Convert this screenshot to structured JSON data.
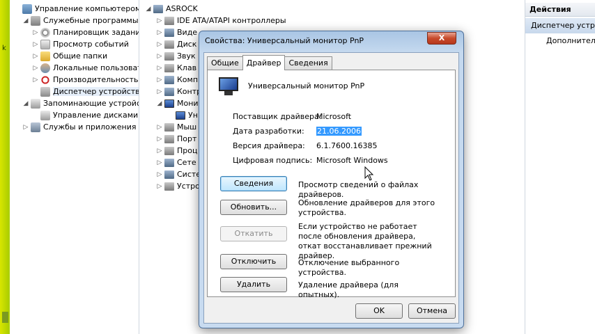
{
  "left_tree": {
    "items": [
      {
        "label": "Управление компьютером (л",
        "icon": "computer-management-icon",
        "expander": ""
      },
      {
        "label": "Служебные программы",
        "icon": "tools-icon",
        "expander": "◢"
      },
      {
        "label": "Планировщик заданий",
        "icon": "task-scheduler-icon",
        "expander": "▷"
      },
      {
        "label": "Просмотр событий",
        "icon": "event-viewer-icon",
        "expander": "▷"
      },
      {
        "label": "Общие папки",
        "icon": "shared-folders-icon",
        "expander": "▷"
      },
      {
        "label": "Локальные пользовате",
        "icon": "local-users-icon",
        "expander": "▷"
      },
      {
        "label": "Производительность",
        "icon": "performance-icon",
        "expander": "▷"
      },
      {
        "label": "Диспетчер устройств",
        "icon": "device-manager-icon",
        "expander": ""
      },
      {
        "label": "Запоминающие устройст",
        "icon": "storage-icon",
        "expander": "◢"
      },
      {
        "label": "Управление дисками",
        "icon": "disk-management-icon",
        "expander": ""
      },
      {
        "label": "Службы и приложения",
        "icon": "services-icon",
        "expander": "▷"
      }
    ]
  },
  "device_tree": {
    "root": "ASROCK",
    "items": [
      {
        "label": "IDE ATA/ATAPI контроллеры",
        "expander": "▷"
      },
      {
        "label": "Виде",
        "expander": "▷"
      },
      {
        "label": "Диск",
        "expander": "▷"
      },
      {
        "label": "Звук",
        "expander": "▷"
      },
      {
        "label": "Клав",
        "expander": "▷"
      },
      {
        "label": "Комп",
        "expander": "▷"
      },
      {
        "label": "Контр",
        "expander": "▷"
      },
      {
        "label": "Мони",
        "expander": "◢"
      },
      {
        "label": "Ун",
        "expander": ""
      },
      {
        "label": "Мыш",
        "expander": "▷"
      },
      {
        "label": "Порт",
        "expander": "▷"
      },
      {
        "label": "Проц",
        "expander": "▷"
      },
      {
        "label": "Сете",
        "expander": "▷"
      },
      {
        "label": "Систе",
        "expander": "▷"
      },
      {
        "label": "Устро",
        "expander": "▷"
      }
    ]
  },
  "actions_pane": {
    "header": "Действия",
    "selected": "Диспетчер устрой",
    "more": "Дополнитель"
  },
  "dialog": {
    "title": "Свойства: Универсальный монитор PnP",
    "close_label": "X",
    "tabs": [
      "Общие",
      "Драйвер",
      "Сведения"
    ],
    "active_tab": "Драйвер",
    "device_name": "Универсальный монитор PnP",
    "info": {
      "provider_label": "Поставщик драйвера:",
      "provider_value": "Microsoft",
      "date_label": "Дата разработки:",
      "date_value": "21.06.2006",
      "version_label": "Версия драйвера:",
      "version_value": "6.1.7600.16385",
      "signature_label": "Цифровая подпись:",
      "signature_value": "Microsoft Windows"
    },
    "buttons": {
      "details_label": "Сведения",
      "details_desc": "Просмотр сведений о файлах драйверов.",
      "update_label": "Обновить...",
      "update_desc": "Обновление драйверов для этого устройства.",
      "rollback_label": "Откатить",
      "rollback_desc": "Если устройство не работает после обновления драйвера, откат восстанавливает прежний драйвер.",
      "disable_label": "Отключить",
      "disable_desc": "Отключение выбранного устройства.",
      "uninstall_label": "Удалить",
      "uninstall_desc": "Удаление драйвера (для опытных)."
    },
    "ok_label": "OK",
    "cancel_label": "Отмена"
  },
  "colors": {
    "selection_blue": "#3399ff",
    "dialog_frame": "#c8dbf0",
    "close_red": "#c74a2b"
  }
}
